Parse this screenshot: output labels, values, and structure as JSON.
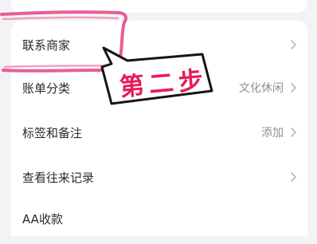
{
  "menu": {
    "items": [
      {
        "label": "联系商家",
        "value": ""
      },
      {
        "label": "账单分类",
        "value": "文化休闲"
      },
      {
        "label": "标签和备注",
        "value": "添加"
      },
      {
        "label": "查看往来记录",
        "value": ""
      },
      {
        "label": "AA收款",
        "value": ""
      }
    ]
  },
  "annotation": {
    "text": "第二步",
    "color": "#e51d57"
  },
  "colors": {
    "background": "#f3f3f5",
    "card": "#ffffff",
    "highlight": "#e84a8c"
  }
}
